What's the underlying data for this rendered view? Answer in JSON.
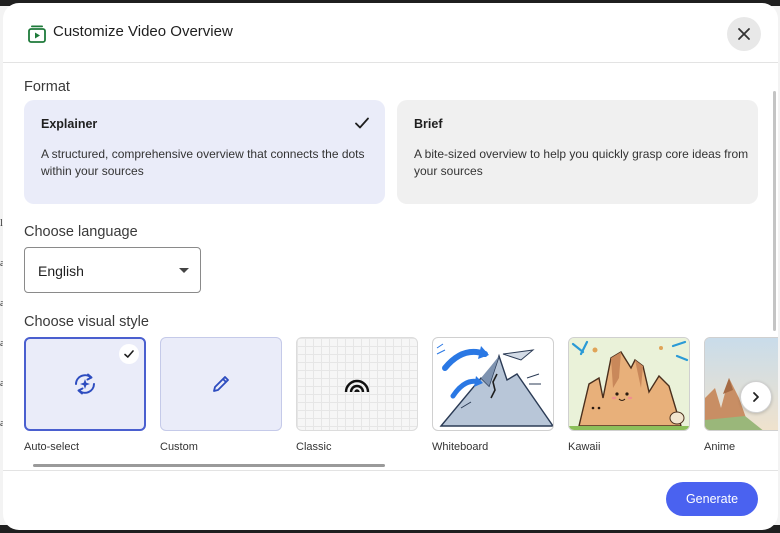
{
  "dialog": {
    "title": "Customize Video Overview"
  },
  "format": {
    "label": "Format",
    "options": [
      {
        "title": "Explainer",
        "description": "A structured, comprehensive overview that connects the dots within your sources",
        "selected": true
      },
      {
        "title": "Brief",
        "description": "A bite-sized overview to help you quickly grasp core ideas from your sources",
        "selected": false
      }
    ]
  },
  "language": {
    "label": "Choose language",
    "selected": "English"
  },
  "visual_style": {
    "label": "Choose visual style",
    "styles": [
      {
        "name": "Auto-select",
        "icon": "auto-select-icon",
        "selected": true
      },
      {
        "name": "Custom",
        "icon": "pencil-icon",
        "selected": false
      },
      {
        "name": "Classic",
        "icon": "rainbow-icon",
        "selected": false
      },
      {
        "name": "Whiteboard",
        "icon": "whiteboard-illustration",
        "selected": false
      },
      {
        "name": "Kawaii",
        "icon": "kawaii-illustration",
        "selected": false
      },
      {
        "name": "Anime",
        "icon": "anime-illustration",
        "selected": false
      }
    ]
  },
  "footer": {
    "generate_label": "Generate"
  },
  "colors": {
    "accent": "#4a62f0",
    "selected_card": "#eaecf9",
    "selected_border": "#4a5fcf"
  }
}
